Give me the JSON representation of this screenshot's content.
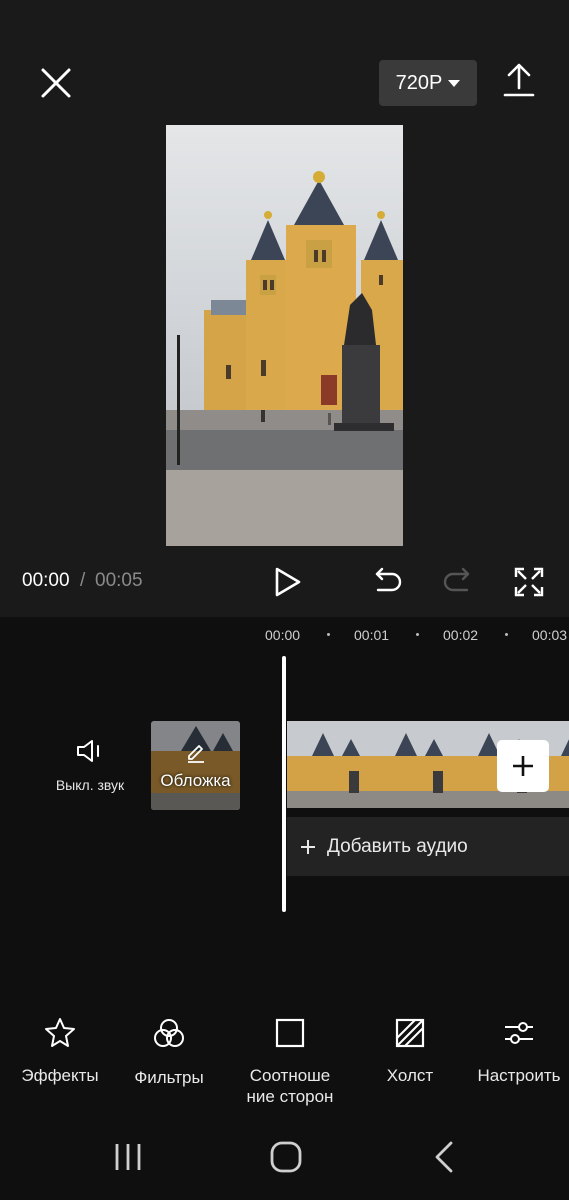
{
  "header": {
    "resolution_label": "720P",
    "close_icon": "close-icon",
    "export_icon": "upload-icon"
  },
  "player": {
    "current_time": "00:00",
    "separator": "/",
    "total_time": "00:05"
  },
  "timeline": {
    "ticks": [
      "00:00",
      "00:01",
      "00:02",
      "00:03"
    ],
    "mute_label": "Выкл. звук",
    "cover_label": "Обложка",
    "add_audio_label": "Добавить аудио"
  },
  "tools": [
    {
      "label": "Эффекты",
      "icon": "effects-star-icon"
    },
    {
      "label": "Фильтры",
      "icon": "filters-icon"
    },
    {
      "label": "Соотноше ние сторон",
      "icon": "aspect-ratio-icon"
    },
    {
      "label": "Холст",
      "icon": "canvas-icon"
    },
    {
      "label": "Настроить",
      "icon": "adjust-icon"
    }
  ],
  "colors": {
    "background": "#0f0f0f",
    "panel": "#1a1a1a",
    "audio_track": "#232323",
    "resolution_button": "#3a3a3a"
  }
}
